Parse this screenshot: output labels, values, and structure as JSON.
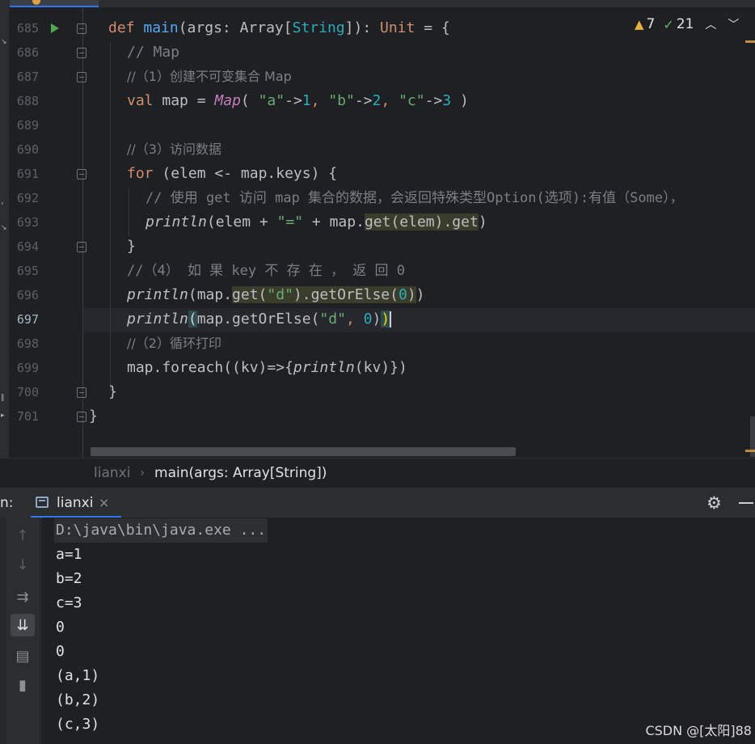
{
  "editor": {
    "line_numbers": [
      "685",
      "686",
      "687",
      "688",
      "689",
      "690",
      "691",
      "692",
      "693",
      "694",
      "695",
      "696",
      "697",
      "698",
      "699",
      "700",
      "701"
    ],
    "current_line": "697",
    "code": {
      "l685": {
        "kw": "def ",
        "fn": "main",
        "a": "(args: ",
        "ty": "Array",
        "b": "[",
        "ty2": "String",
        "c": "]): ",
        "kw2": "Unit",
        "d": " = {"
      },
      "l686": {
        "cm": "// Map"
      },
      "l687": {
        "cm": "//（1）创建不可变集合 Map"
      },
      "l688": {
        "kw": "val ",
        "a": "map = ",
        "mp": "Map",
        "b": "( ",
        "s1": "\"a\"",
        "c": "->",
        "n1": "1",
        "d": ", ",
        "s2": "\"b\"",
        "e": "->",
        "n2": "2",
        "f": ", ",
        "s3": "\"c\"",
        "g": "->",
        "n3": "3",
        "h": " )"
      },
      "l690": {
        "cm": "//（3）访问数据"
      },
      "l691": {
        "kw": "for ",
        "a": "(elem <- map.keys) {"
      },
      "l692": {
        "cm": "// 使用 get 访问 map 集合的数据，会返回特殊类型Option(选项):有值（Some），"
      },
      "l693": {
        "it": "println",
        "a": "(elem + ",
        "s": "\"=\"",
        "b": " + map.",
        "hl": "get(elem).get",
        "c": ")"
      },
      "l694": {
        "a": "}"
      },
      "l695": {
        "cm": "//（4） 如 果 key 不 存 在 ， 返 回 0"
      },
      "l696": {
        "it": "println",
        "a": "(map.",
        "hl": "get(",
        "s": "\"d\"",
        "hl2": ").getOrElse(",
        "n": "0",
        "hl3": ")",
        "b": ")"
      },
      "l697": {
        "it": "println",
        "p1": "(",
        "a": "map.getOrElse(",
        "s": "\"d\"",
        "b": ", ",
        "n": "0",
        "c": ")",
        "p2": ")"
      },
      "l698": {
        "cm": "//（2）循环打印"
      },
      "l699": {
        "a": "map.foreach(",
        "b": "(kv)=>{",
        "it": "println",
        "c": "(kv)})"
      },
      "l700": {
        "a": "}"
      },
      "l701": {
        "a": "}"
      }
    },
    "inspections": {
      "warnings": "7",
      "weak_warnings": "21"
    }
  },
  "breadcrumb": {
    "file": "lianxi",
    "method": "main(args: Array[String])"
  },
  "run_window": {
    "label": "n:",
    "tab_label": "lianxi",
    "console_lines": [
      "D:\\java\\bin\\java.exe ...",
      "a=1",
      "b=2",
      "c=3",
      "0",
      "0",
      "(a,1)",
      "(b,2)",
      "(c,3)"
    ]
  },
  "watermark": "CSDN @[太阳]88"
}
